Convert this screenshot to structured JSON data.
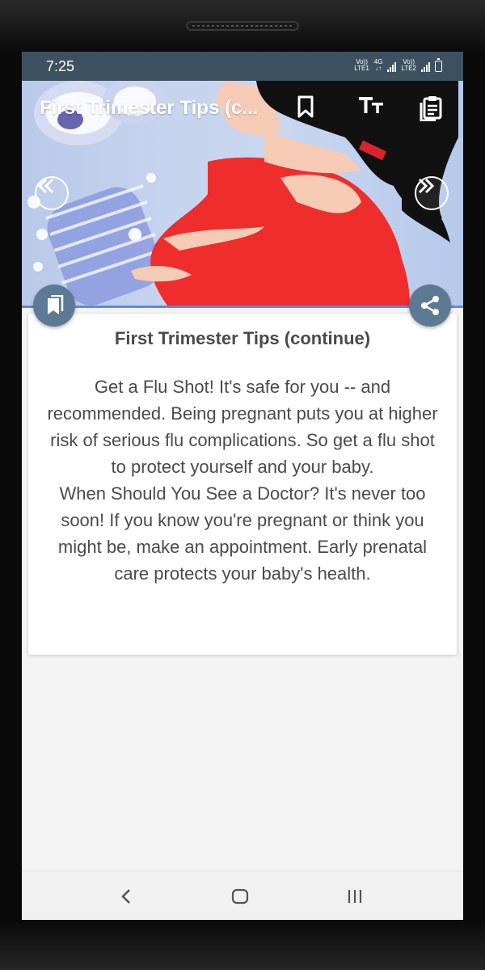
{
  "status_bar": {
    "time": "7:25",
    "sim1_label_top": "Vo))",
    "sim1_label_bottom": "LTE1",
    "net_label_top": "4G",
    "net_label_bottom": "↓↑",
    "sim2_label_top": "Vo))",
    "sim2_label_bottom": "LTE2"
  },
  "toolbar": {
    "title": "First Trimester Tips (c...",
    "icons": [
      "bookmark-outline-icon",
      "text-size-icon",
      "clipboard-icon"
    ]
  },
  "hero": {
    "prev_icon": "double-chevron-left-icon",
    "next_icon": "double-chevron-right-icon"
  },
  "fabs": {
    "left_icon": "bookmarks-icon",
    "right_icon": "share-icon"
  },
  "card": {
    "title": "First Trimester Tips (continue)",
    "paragraph_1": "Get a Flu Shot! It's safe for you -- and recommended. Being pregnant puts you at higher risk of serious flu complications. So get a flu shot to protect yourself and your baby.",
    "paragraph_2": "When Should You See a Doctor? It's never too soon! If you know you're pregnant or think you might be, make an appointment. Early prenatal care protects your baby's health."
  },
  "nav_bar": {
    "icons": [
      "back-icon",
      "home-icon",
      "recents-icon"
    ]
  },
  "colors": {
    "status_bar": "#3d5261",
    "fab": "#5c7a93",
    "dress": "#ef2d2d",
    "text": "#4a4a4a"
  }
}
